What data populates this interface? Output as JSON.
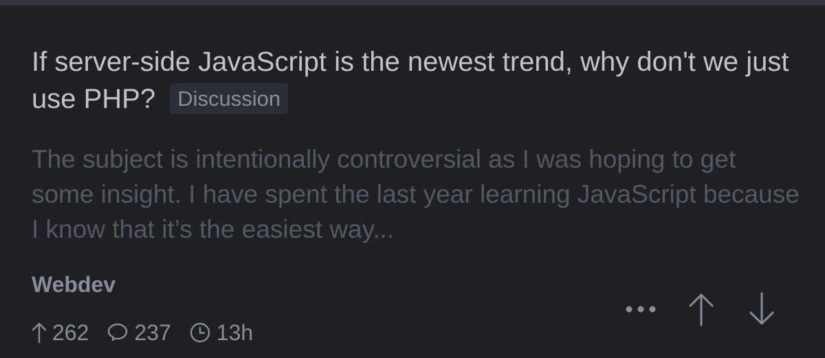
{
  "post": {
    "title": "If server-side JavaScript is the newest trend, why don't we just use PHP?",
    "flair": "Discussion",
    "preview": "The subject is intentionally controversial as I was hoping to get some insight. I have spent the last year learning JavaScript because I know that it’s the easiest way...",
    "community": "Webdev",
    "stats": {
      "score": "262",
      "comments": "237",
      "age": "13h"
    }
  },
  "icons": {
    "score": "arrow-up-icon",
    "comments": "comment-bubble-icon",
    "age": "clock-icon",
    "more": "more-dots-icon",
    "upvote": "upvote-arrow-icon",
    "downvote": "downvote-arrow-icon"
  },
  "colors": {
    "background": "#1f2026",
    "title": "#c3c4c8",
    "preview": "#56585f",
    "meta": "#8b8d94",
    "flair_bg": "#2c2e35"
  }
}
